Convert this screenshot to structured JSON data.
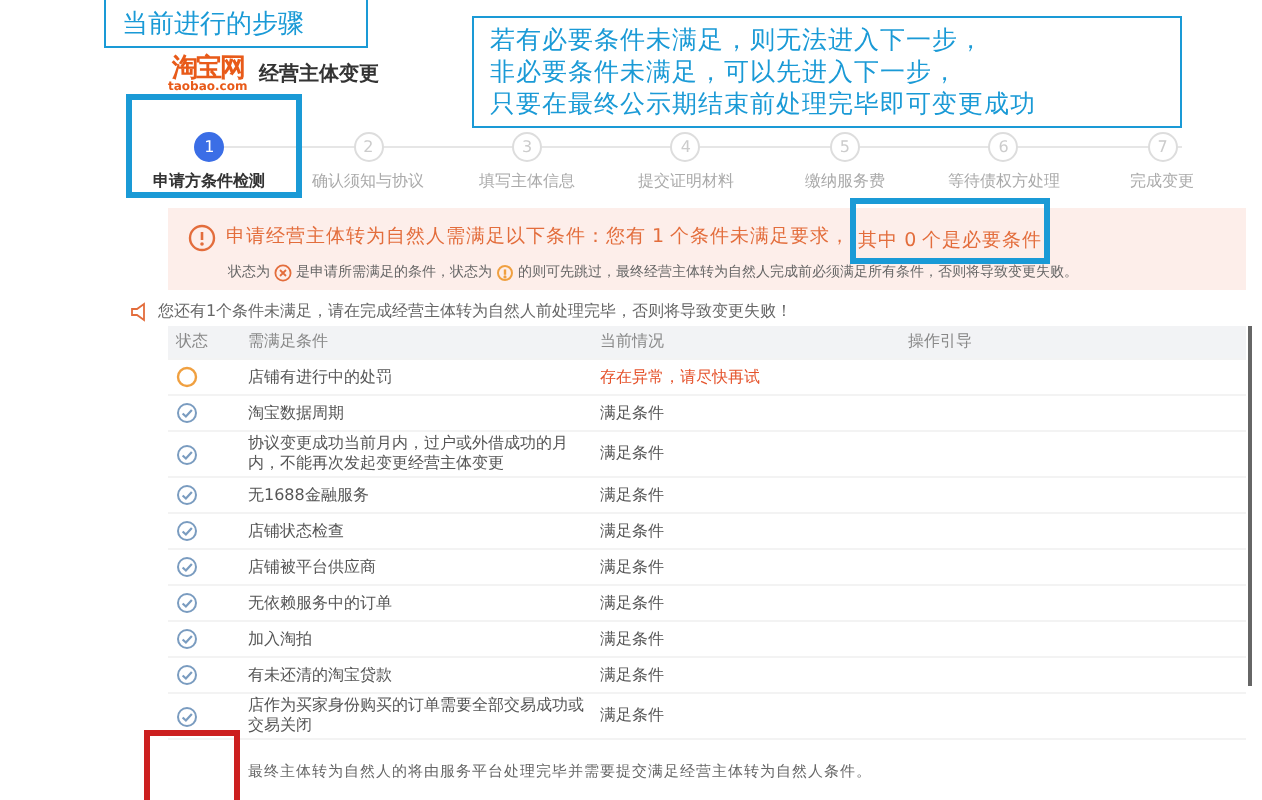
{
  "callouts": [
    {
      "text": "当前进行的步骤",
      "kind": "label"
    },
    {
      "lines": [
        "若有必要条件未满足，则无法进入下一步，",
        "非必要条件未满足，可以先进入下一步，",
        "只要在最终公示期结束前处理完毕即可变更成功"
      ],
      "kind": "note"
    }
  ],
  "logo": {
    "brand": "淘宝网",
    "domain": "taobao.com",
    "title": "经营主体变更"
  },
  "steps": [
    {
      "number": "1",
      "label": "申请方条件检测",
      "selected": true
    },
    {
      "number": "2",
      "label": "确认须知与协议",
      "selected": false
    },
    {
      "number": "3",
      "label": "填写主体信息",
      "selected": false
    },
    {
      "number": "4",
      "label": "提交证明材料",
      "selected": false
    },
    {
      "number": "5",
      "label": "缴纳服务费",
      "selected": false
    },
    {
      "number": "6",
      "label": "等待债权方处理",
      "selected": false
    },
    {
      "number": "7",
      "label": "完成变更",
      "selected": false
    }
  ],
  "notice": {
    "headline": "申请经营主体转为自然人需满足以下条件：您有 1 个条件未满足要求，",
    "highlighted": "其中 0 个是必要条件",
    "legend_parts": [
      "状态为",
      "是申请所需满足的条件，状态为",
      "的则可先跳过，最终经营主体转为自然人完成前必须满足所有条件，否则将导致变更失败。"
    ]
  },
  "summary": "您还有1个条件未满足，请在完成经营主体转为自然人前处理完毕，否则将导致变更失败！",
  "table": {
    "columns": [
      "状态",
      "需满足条件",
      "当前情况",
      "操作引导"
    ],
    "rows": [
      {
        "kind": "warning",
        "condition": "店铺有进行中的处罚",
        "current": "存在异常，请尽快再试"
      },
      {
        "kind": "ok",
        "condition": "淘宝数据周期",
        "current": "满足条件"
      },
      {
        "kind": "ok",
        "condition": "协议变更成功当前月内，过户或外借成功的月内，不能再次发起变更经营主体变更",
        "current": "满足条件"
      },
      {
        "kind": "ok",
        "condition": "无1688金融服务",
        "current": "满足条件"
      },
      {
        "kind": "ok",
        "condition": "店铺状态检查",
        "current": "满足条件"
      },
      {
        "kind": "ok",
        "condition": "店铺被平台供应商",
        "current": "满足条件"
      },
      {
        "kind": "ok",
        "condition": "无依赖服务中的订单",
        "current": "满足条件"
      },
      {
        "kind": "ok",
        "condition": "加入淘拍",
        "current": "满足条件"
      },
      {
        "kind": "ok",
        "condition": "有未还清的淘宝贷款",
        "current": "满足条件"
      },
      {
        "kind": "ok",
        "condition": "店作为买家身份购买的订单需要全部交易成功或交易关闭",
        "current": "满足条件"
      }
    ]
  },
  "footer": "最终主体转为自然人的将由服务平台处理完毕并需要提交满足经营主体转为自然人条件。",
  "highlight_boxes": [
    {
      "color": "#1a9ad6"
    },
    {
      "color": "#1a9ad6"
    },
    {
      "color": "#cc1f1f"
    }
  ]
}
